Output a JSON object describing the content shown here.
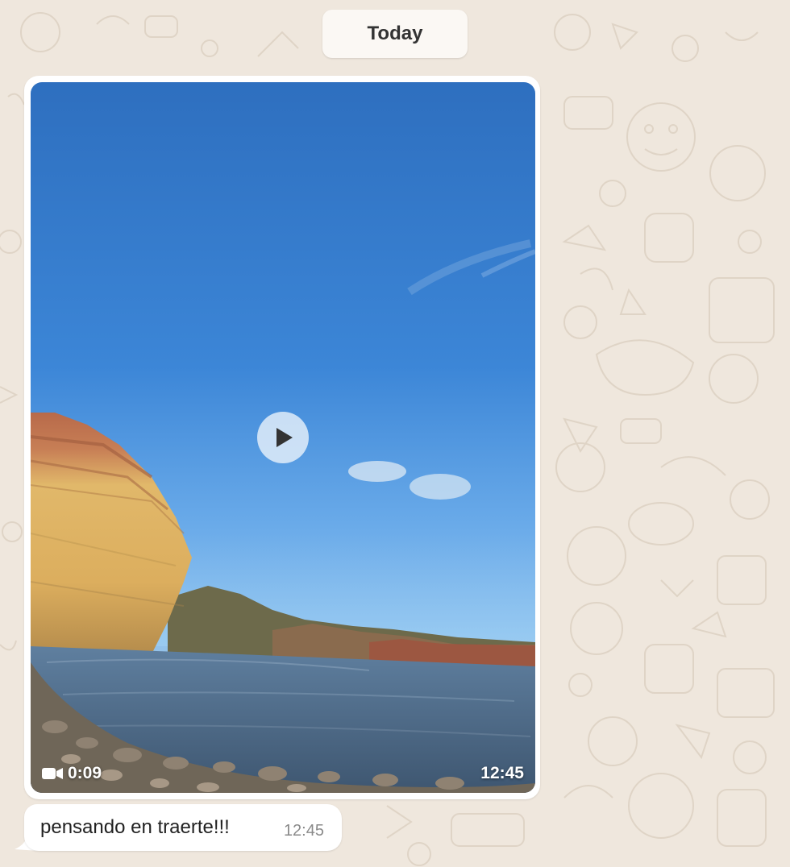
{
  "date_divider": {
    "label": "Today"
  },
  "video_message": {
    "duration": "0:09",
    "timestamp": "12:45",
    "play_icon": "play-icon",
    "camera_icon": "video-camera-icon"
  },
  "text_message": {
    "text": "pensando en traerte!!!",
    "timestamp": "12:45"
  },
  "colors": {
    "background": "#efe7dd",
    "bubble": "#ffffff",
    "chip": "#fbf8f4",
    "sky": "#3c86d7",
    "time_text": "#8a8a8a"
  }
}
